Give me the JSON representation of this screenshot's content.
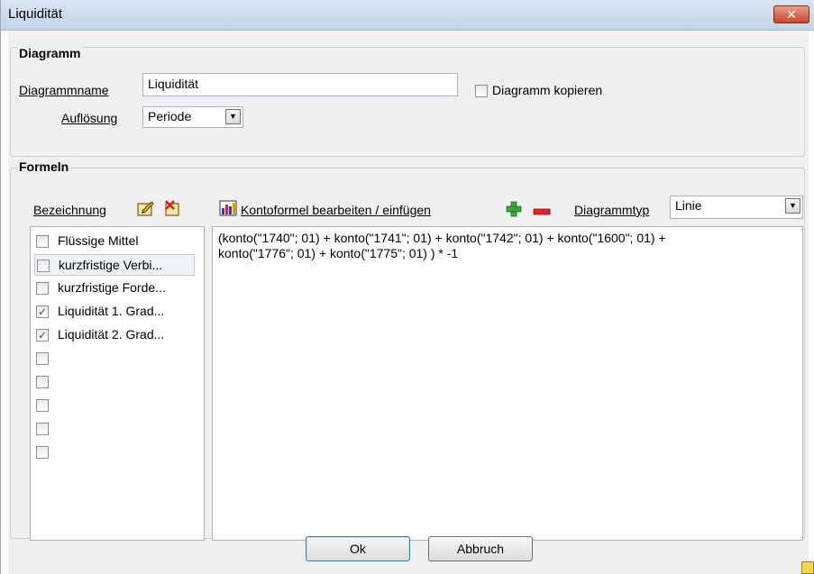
{
  "window": {
    "title": "Liquidität",
    "close_label": "✕"
  },
  "diagramm": {
    "group_title": "Diagramm",
    "name_label": "Diagrammname",
    "name_value": "Liquidität",
    "copy_label": "Diagramm kopieren",
    "copy_checked": false,
    "resolution_label": "Auflösung",
    "resolution_value": "Periode"
  },
  "formeln": {
    "group_title": "Formeln",
    "bezeichnung_label": "Bezeichnung",
    "kontoformel_label": "Kontoformel bearbeiten / einfügen",
    "diagrammtyp_label": "Diagrammtyp",
    "diagrammtyp_value": "Linie",
    "items": [
      {
        "label": "Flüssige Mittel",
        "checked": false
      },
      {
        "label": "kurzfristige Verbi...",
        "checked": false
      },
      {
        "label": "kurzfristige Forde...",
        "checked": false
      },
      {
        "label": "Liquidität 1. Grad...",
        "checked": true
      },
      {
        "label": "Liquidität 2. Grad...",
        "checked": true
      },
      {
        "label": "",
        "checked": false
      },
      {
        "label": "",
        "checked": false
      },
      {
        "label": "",
        "checked": false
      },
      {
        "label": "",
        "checked": false
      },
      {
        "label": "",
        "checked": false
      }
    ],
    "formula_line1": "(konto(\"1740\"; 01) + konto(\"1741\"; 01) + konto(\"1742\"; 01) + konto(\"1600\"; 01) +",
    "formula_line2": "konto(\"1776\"; 01) + konto(\"1775\"; 01) ) * -1"
  },
  "buttons": {
    "ok": "Ok",
    "cancel": "Abbruch"
  },
  "colors": {
    "accent_plus": "#3aa43a",
    "accent_minus": "#e0262c"
  },
  "icons": {
    "edit": "edit-note-icon",
    "delete": "delete-note-icon",
    "kontoformel": "chart-formula-icon",
    "add": "plus-icon",
    "remove": "minus-icon"
  }
}
